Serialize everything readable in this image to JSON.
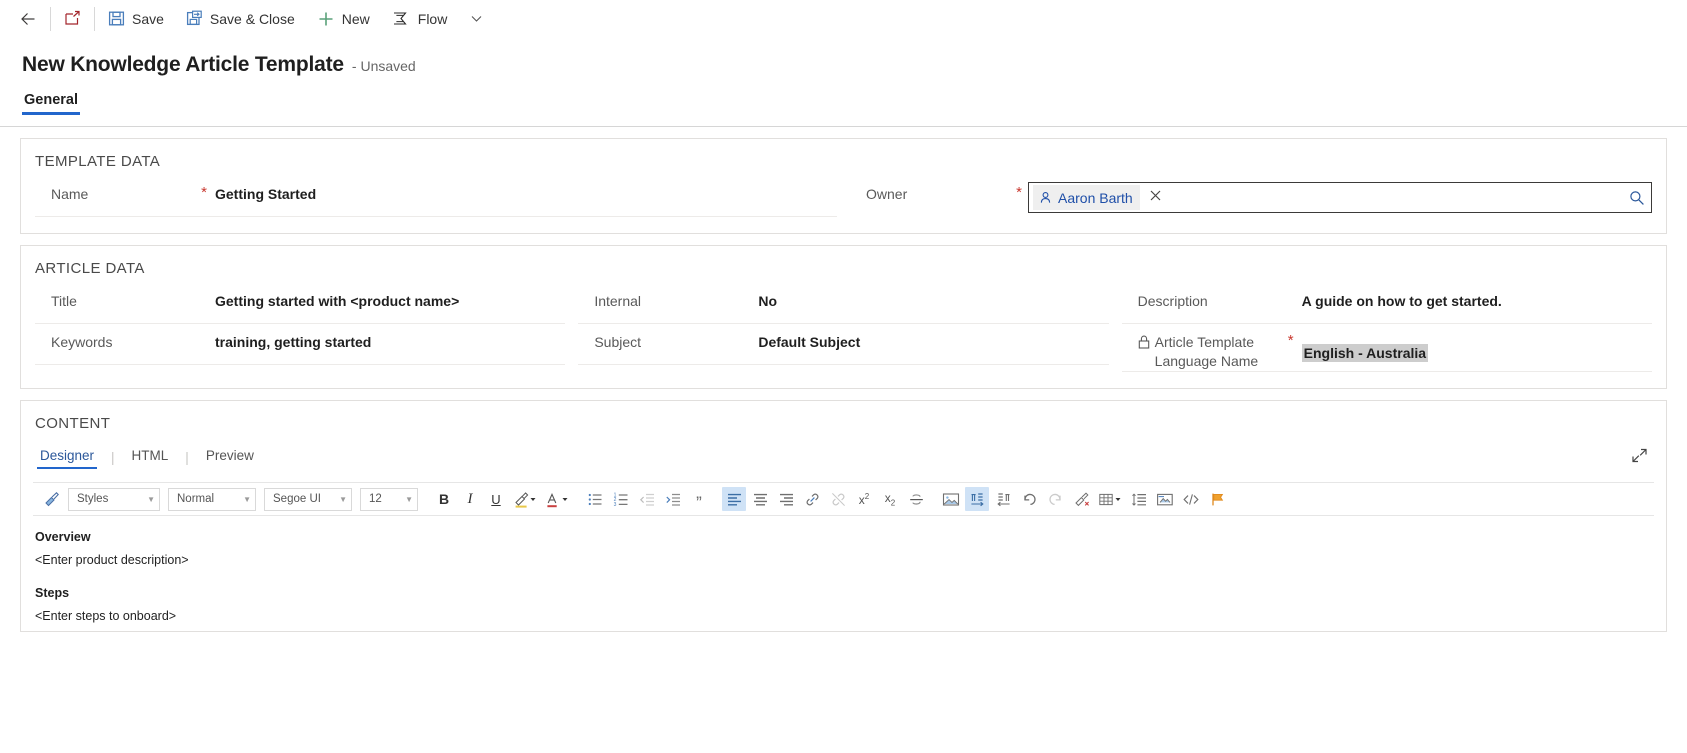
{
  "commandbar": {
    "back_tooltip": "Back",
    "popout_tooltip": "Open in new window",
    "items": [
      {
        "label": "Save",
        "icon": "save-icon"
      },
      {
        "label": "Save & Close",
        "icon": "save-and-close-icon"
      },
      {
        "label": "New",
        "icon": "plus-icon"
      },
      {
        "label": "Flow",
        "icon": "flow-icon"
      }
    ],
    "overflow_label": "More commands"
  },
  "record": {
    "title": "New Knowledge Article Template",
    "state": "- Unsaved"
  },
  "form_tabs": [
    {
      "label": "General",
      "active": true
    }
  ],
  "sections": {
    "template_data": {
      "title": "TEMPLATE DATA",
      "name": {
        "label": "Name",
        "required": "*",
        "value": "Getting Started"
      },
      "owner": {
        "label": "Owner",
        "required": "*",
        "chip": "Aaron Barth",
        "remove_label": "Remove",
        "search_label": "Lookup"
      }
    },
    "article_data": {
      "title": "ARTICLE DATA",
      "fields": [
        {
          "label": "Title",
          "required": "",
          "value": "Getting started with <product name>"
        },
        {
          "label": "Keywords",
          "required": "",
          "value": "training, getting started"
        },
        {
          "label": "Internal",
          "required": "",
          "value": "No"
        },
        {
          "label": "Subject",
          "required": "",
          "value": "Default Subject"
        },
        {
          "label": "Description",
          "required": "",
          "value": "A guide on how to get started."
        },
        {
          "label": "Article Template Language Name",
          "label_line1": "Article Template",
          "label_line2": "Language Name",
          "required": "*",
          "value": "English - Australia",
          "locked": true,
          "highlighted": true
        }
      ]
    },
    "content": {
      "title": "CONTENT",
      "tabs": [
        {
          "label": "Designer",
          "active": true
        },
        {
          "label": "HTML",
          "active": false
        },
        {
          "label": "Preview",
          "active": false
        }
      ],
      "expand_label": "Expand",
      "toolbar": {
        "format_painter": "format-painter-icon",
        "styles": "Styles",
        "paragraph_format": "Normal",
        "font": "Segoe UI",
        "size": "12",
        "bold": "B",
        "italic": "I",
        "underline": "U",
        "highlight": "highlight-color-icon",
        "font_color": "font-color-icon",
        "bullets": "bulleted-list-icon",
        "numbering": "numbered-list-icon",
        "outdent": "decrease-indent-icon",
        "indent": "increase-indent-icon",
        "blockquote": "block-quote-icon",
        "align_left": "align-left-icon",
        "align_center": "align-center-icon",
        "align_right": "align-right-icon",
        "link": "insert-link-icon",
        "unlink": "remove-link-icon",
        "superscript": "superscript-icon",
        "subscript": "subscript-icon",
        "strikethrough": "strikethrough-icon",
        "image": "insert-image-icon",
        "ltr": "left-to-right-icon",
        "rtl": "right-to-left-icon",
        "undo": "undo-icon",
        "redo": "redo-icon",
        "clear_format": "clear-formatting-icon",
        "table": "insert-table-icon",
        "line_spacing": "line-spacing-icon",
        "insert_snippet": "insert-snippet-icon",
        "code_view": "code-view-icon",
        "flag": "flag-icon"
      },
      "body": {
        "heading_1": "Overview",
        "para_1": "<Enter product description>",
        "heading_2": "Steps",
        "para_2": "<Enter steps to onboard>"
      }
    }
  },
  "colors": {
    "accent": "#2266cc",
    "required": "#c8372e",
    "link": "#1f4fa8",
    "toolbar_active": "#cfe2f6",
    "selection": "#cdcdcd",
    "save_icon": "#4a7ebb",
    "new_icon": "#5aa17a"
  }
}
